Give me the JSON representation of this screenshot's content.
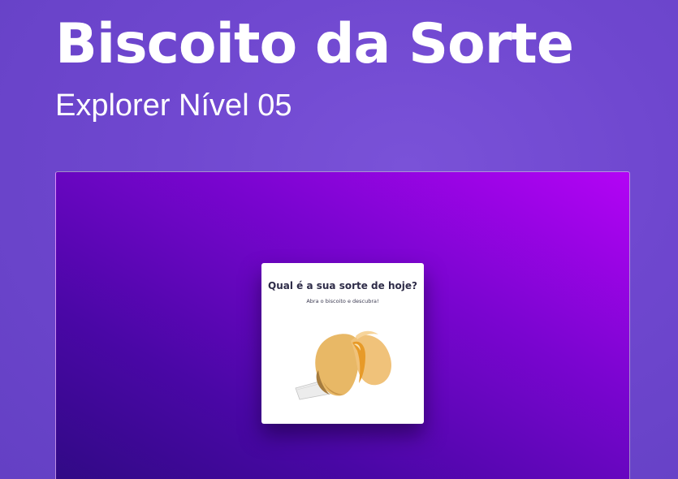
{
  "header": {
    "title": "Biscoito da Sorte",
    "subtitle": "Explorer Nível 05"
  },
  "card": {
    "question": "Qual é a sua sorte de hoje?",
    "instruction": "Abra o biscoito e descubra!",
    "image_icon": "fortune-cookie-icon"
  },
  "colors": {
    "background": "#6f47cf",
    "preview_gradient_start": "#2e0a82",
    "preview_gradient_end": "#b304f5",
    "cookie": "#e8b866",
    "card_text": "#2e2c48"
  }
}
